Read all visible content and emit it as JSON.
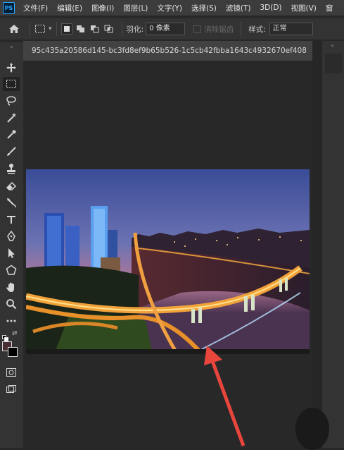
{
  "menubar": {
    "app_icon": "PS",
    "items": [
      "文件(F)",
      "编辑(E)",
      "图像(I)",
      "图层(L)",
      "文字(Y)",
      "选择(S)",
      "滤镜(T)",
      "3D(D)",
      "视图(V)",
      "窗"
    ]
  },
  "options": {
    "feather_label": "羽化:",
    "feather_value": "0 像素",
    "antialias_label": "消除锯齿",
    "style_label": "样式:",
    "style_value": "正常"
  },
  "document": {
    "tab_title": "95c435a20586d145-bc3fd8ef9b65b526-1c5cb42fbba1643c4932670ef408"
  },
  "tools": [
    "move-icon",
    "marquee-icon",
    "lasso-icon",
    "magic-wand-icon",
    "eyedropper-icon",
    "brush-icon",
    "stamp-icon",
    "eraser-icon",
    "pen-curve-icon",
    "type-icon",
    "pen-icon",
    "path-select-icon",
    "shape-icon",
    "hand-icon",
    "zoom-icon",
    "more-icon"
  ],
  "colors": {
    "foreground": "#4a2f32",
    "background": "#000000",
    "arrow": "#e8463c"
  }
}
